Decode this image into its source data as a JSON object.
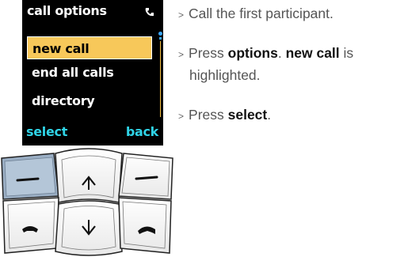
{
  "screen": {
    "title": "call options",
    "menu_items": [
      "new call",
      "end all calls",
      "directory"
    ],
    "selected_index": 0,
    "softkey_left": "select",
    "softkey_right": "back"
  },
  "steps": [
    {
      "bullet": ">",
      "text": "Call the first participant."
    },
    {
      "bullet": ">",
      "pre": "Press",
      "bold1": "options",
      "mid": ".",
      "bold2": "new call",
      "post": "is",
      "cont": "highlighted."
    },
    {
      "bullet": ">",
      "pre": "Press",
      "bold1": "select",
      "post": "."
    }
  ],
  "colors": {
    "screen_bg": "#000000",
    "highlight": "#f7c85a",
    "softkey": "#2fd3e6",
    "scrollbar": "#f5c042",
    "pressed_key": "#9aaec4"
  },
  "keypad_icons": [
    "left-softkey-icon",
    "right-softkey-icon",
    "up-arrow-icon",
    "down-arrow-icon",
    "call-handset-icon",
    "end-call-handset-icon"
  ]
}
